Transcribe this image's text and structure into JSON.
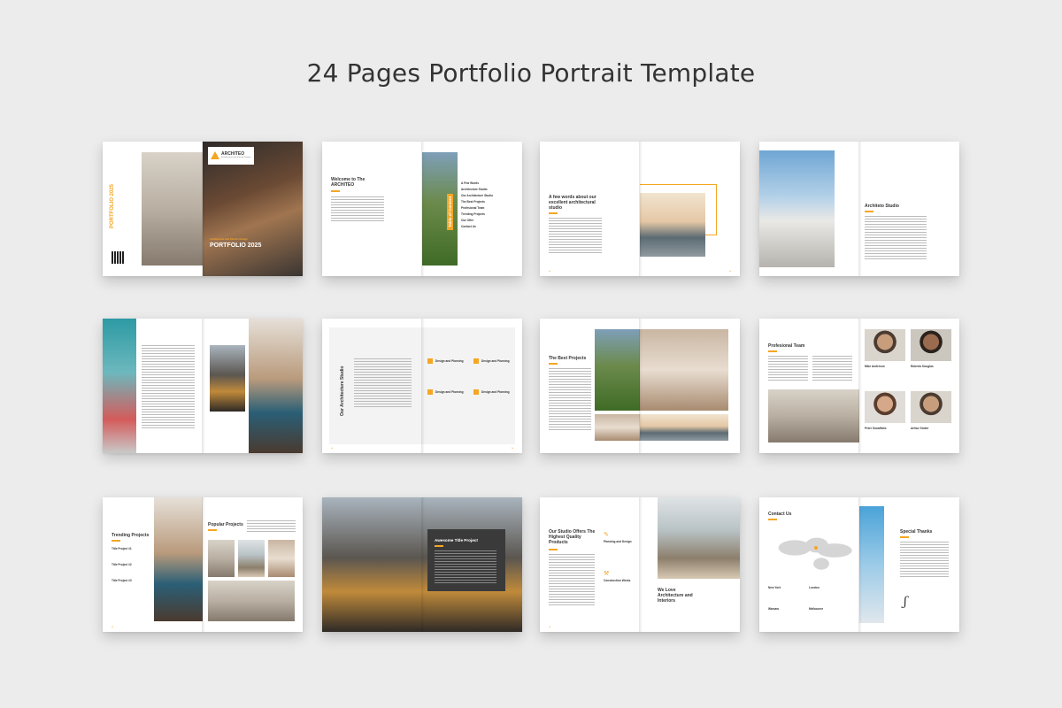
{
  "header": {
    "title": "24 Pages Portfolio Portrait Template"
  },
  "brand": {
    "name": "ARCHITEO",
    "tagline": "Architecture and Interior Design"
  },
  "cover": {
    "vertical_title": "PORTFOLIO 2025",
    "subtitle": "Architecture and Interior Design",
    "title": "PORTFOLIO 2025"
  },
  "welcome": {
    "title": "Welcome to The ARCHITEO",
    "toc_label": "Table of Content",
    "toc_items": [
      "A Few Words",
      "Architecture Studio",
      "Our Architecture Studio",
      "The Best Projects",
      "Profesional Team",
      "Trending Projects",
      "Our Offer",
      "Contact Us"
    ]
  },
  "few_words": {
    "title": "A few words about our excellent architectural studio"
  },
  "studio": {
    "title": "Architeto Studio"
  },
  "our_studio": {
    "vertical_title": "Our Architecture Studio",
    "items": [
      "Design and Planning",
      "Design and Planning",
      "Design and Planning",
      "Design and Planning"
    ]
  },
  "best_projects": {
    "title": "The Best Projects"
  },
  "team": {
    "title": "Profesional Team",
    "members": [
      "Mike Anderson",
      "Roberto Douglas",
      "Peter Snowflake",
      "Arthur Smiler"
    ]
  },
  "trending": {
    "title": "Trending Projects",
    "items": [
      "Title Project #1",
      "Title Project #2",
      "Title Project #3"
    ]
  },
  "popular": {
    "title": "Popular Projects"
  },
  "awesome": {
    "title": "Awesome Title Project"
  },
  "offers": {
    "title": "Our Studio Offers The Highest Quality Products",
    "items": [
      "Planning and Design",
      "Construction Works"
    ],
    "tagline": "We Love Architecture and Interiors"
  },
  "contact": {
    "title": "Contact Us",
    "cities": [
      "New York",
      "London",
      "Warsaw",
      "Melbourne"
    ],
    "thanks": "Special Thanks"
  },
  "colors": {
    "accent": "#f5a623",
    "background": "#ececec",
    "text": "#333333"
  }
}
